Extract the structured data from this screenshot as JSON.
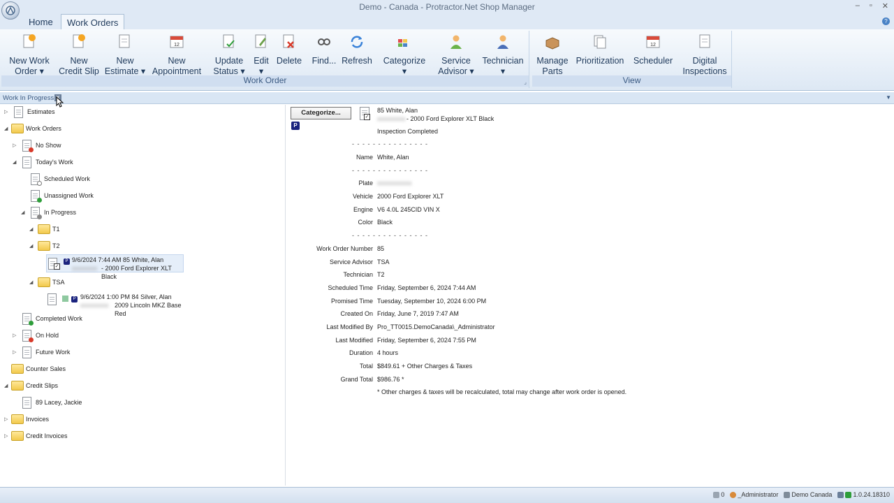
{
  "window": {
    "title": "Demo - Canada - Protractor.Net Shop Manager",
    "controls": [
      "–",
      "▫",
      "✕"
    ]
  },
  "tabs": [
    "Home",
    "Work Orders"
  ],
  "ribbon": {
    "work_order_group": {
      "label": "Work Order",
      "buttons": [
        {
          "line1": "New Work",
          "line2": "Order ▾",
          "icon": "new-work-order-icon"
        },
        {
          "line1": "New",
          "line2": "Credit Slip",
          "icon": "new-credit-slip-icon"
        },
        {
          "line1": "New",
          "line2": "Estimate ▾",
          "icon": "new-estimate-icon"
        },
        {
          "line1": "New",
          "line2": "Appointment",
          "icon": "new-appointment-icon"
        },
        {
          "line1": "Update",
          "line2": "Status ▾",
          "icon": "update-status-icon"
        },
        {
          "line1": "Edit",
          "line2": "▾",
          "icon": "edit-icon"
        },
        {
          "line1": "Delete",
          "line2": "",
          "icon": "delete-icon"
        },
        {
          "line1": "Find...",
          "line2": "",
          "icon": "find-icon"
        },
        {
          "line1": "Refresh",
          "line2": "",
          "icon": "refresh-icon"
        },
        {
          "line1": "Categorize",
          "line2": "▾",
          "icon": "categorize-icon"
        },
        {
          "line1": "Service",
          "line2": "Advisor ▾",
          "icon": "service-advisor-icon"
        },
        {
          "line1": "Technician",
          "line2": "▾",
          "icon": "technician-icon"
        }
      ]
    },
    "view_group": {
      "label": "View",
      "buttons": [
        {
          "line1": "Manage",
          "line2": "Parts",
          "icon": "manage-parts-icon"
        },
        {
          "line1": "Prioritization",
          "line2": "",
          "icon": "prioritization-icon"
        },
        {
          "line1": "Scheduler",
          "line2": "",
          "icon": "scheduler-icon"
        },
        {
          "line1": "Digital",
          "line2": "Inspections",
          "icon": "digital-inspections-icon"
        }
      ]
    }
  },
  "panel": {
    "title": "Work In Progress"
  },
  "tree": {
    "estimates": "Estimates",
    "work_orders": "Work Orders",
    "no_show": "No Show",
    "todays_work": "Today's Work",
    "scheduled_work": "Scheduled Work",
    "unassigned_work": "Unassigned Work",
    "in_progress": "In Progress",
    "t1": "T1",
    "t2": "T2",
    "t2_entry": {
      "line1": "9/6/2024 7:44 AM 85 White, Alan",
      "line2_blur": "xxxxxxxx",
      "line2": "- 2000 Ford Explorer XLT Black"
    },
    "tsa": "TSA",
    "tsa_entry": {
      "line1": "9/6/2024 1:00 PM 84 Silver, Alan",
      "line2_blur": "xxxxxxxxx",
      "line2": "2009 Lincoln MKZ Base Red"
    },
    "completed_work": "Completed Work",
    "on_hold": "On Hold",
    "future_work": "Future Work",
    "counter_sales": "Counter Sales",
    "credit_slips": "Credit Slips",
    "credit_slip_item": "89 Lacey, Jackie",
    "invoices": "Invoices",
    "credit_invoices": "Credit Invoices"
  },
  "detail": {
    "categorize_button": "Categorize...",
    "priority_badge": "P",
    "header": {
      "line1": "85 White, Alan",
      "line2_blur": "xxxxxxxxx",
      "line2": "- 2000 Ford Explorer XLT Black",
      "line3": "Inspection Completed"
    },
    "separator": "- - - - -   - - - - - - - - - -",
    "name": {
      "label": "Name",
      "value": "White, Alan"
    },
    "plate": {
      "label": "Plate",
      "value": "xxxxxxxxxxx"
    },
    "vehicle": {
      "label": "Vehicle",
      "value": "2000 Ford Explorer XLT"
    },
    "engine": {
      "label": "Engine",
      "value": "V6 4.0L 245CID VIN X"
    },
    "color": {
      "label": "Color",
      "value": "Black"
    },
    "fields": [
      {
        "label": "Work Order Number",
        "value": "85"
      },
      {
        "label": "Service Advisor",
        "value": "TSA"
      },
      {
        "label": "Technician",
        "value": "T2"
      },
      {
        "label": "Scheduled Time",
        "value": "Friday, September 6, 2024 7:44 AM"
      },
      {
        "label": "Promised Time",
        "value": "Tuesday, September 10, 2024 6:00 PM"
      },
      {
        "label": "Created On",
        "value": "Friday, June 7, 2019 7:47 AM"
      },
      {
        "label": "Last Modified By",
        "value": "Pro_TT0015.DemoCanada\\_Administrator"
      },
      {
        "label": "Last Modified",
        "value": "Friday, September 6, 2024 7:55 PM"
      },
      {
        "label": "Duration",
        "value": "4 hours"
      },
      {
        "label": "Total",
        "value": "$849.61 + Other Charges & Taxes"
      },
      {
        "label": "Grand Total",
        "value": "$986.76 *"
      }
    ],
    "footnote": "* Other charges & taxes will be recalculated, total may change after work order is opened."
  },
  "status": {
    "count": "0",
    "user": "_Administrator",
    "company": "Demo Canada",
    "version": "1.0.24.18310"
  },
  "colors": {
    "accent": "#1e395b",
    "ribbon_bg": "#dde8f4",
    "priority": "#1a237e"
  }
}
